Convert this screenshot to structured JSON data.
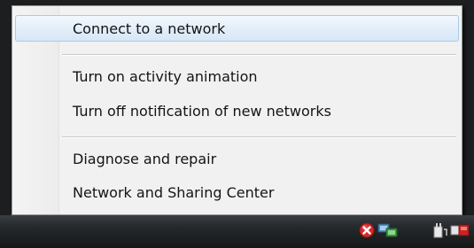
{
  "context_menu": {
    "items": [
      {
        "label": "Connect to a network"
      },
      {
        "label": "Turn on activity animation"
      },
      {
        "label": "Turn off notification of new networks"
      },
      {
        "label": "Diagnose and repair"
      },
      {
        "label": "Network and Sharing Center"
      }
    ]
  },
  "tray": {
    "icons": [
      "network-error-icon",
      "network-icon",
      "power-icon",
      "volume-icon"
    ]
  },
  "colors": {
    "menu_background": "#f1f1f1",
    "highlight": "#dcebf8",
    "taskbar": "#26292c",
    "error_red": "#d22a2a"
  }
}
